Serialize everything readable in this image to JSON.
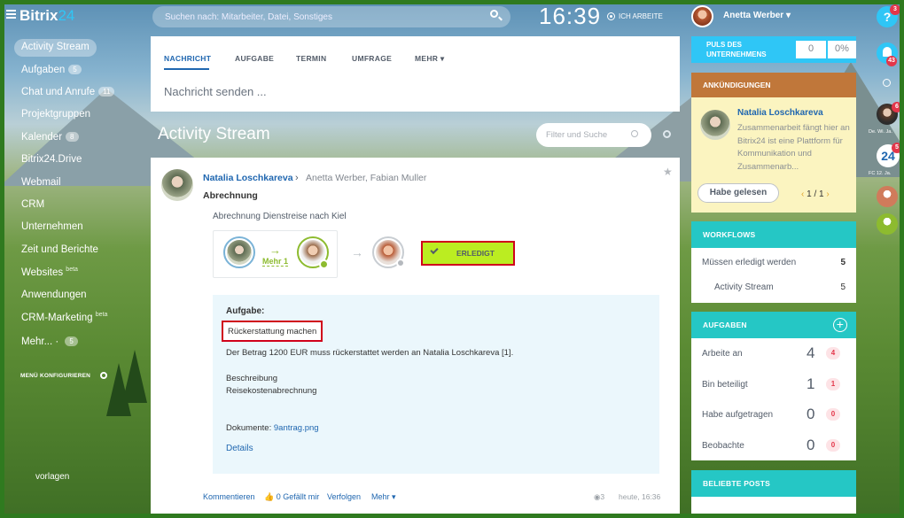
{
  "header": {
    "logo": "Bitrix",
    "logo_num": "24",
    "search_placeholder": "Suchen nach: Mitarbeiter, Datei, Sonstiges",
    "time": "16:39",
    "work_status": "ICH ARBEITE",
    "user_name": "Anetta Werber"
  },
  "menu": {
    "items": [
      {
        "label": "Activity Stream"
      },
      {
        "label": "Aufgaben",
        "count": "5"
      },
      {
        "label": "Chat und Anrufe",
        "count": "11"
      },
      {
        "label": "Projektgruppen"
      },
      {
        "label": "Kalender",
        "count": "8"
      },
      {
        "label": "Bitrix24.Drive"
      },
      {
        "label": "Webmail"
      },
      {
        "label": "CRM"
      },
      {
        "label": "Unternehmen"
      },
      {
        "label": "Zeit und Berichte"
      },
      {
        "label": "Websites",
        "beta": "beta"
      },
      {
        "label": "Anwendungen"
      },
      {
        "label": "CRM-Marketing",
        "beta": "beta"
      },
      {
        "label": "Mehr...",
        "count": "5"
      }
    ],
    "configure": "MENÜ KONFIGURIEREN",
    "templates": "vorlagen"
  },
  "composer": {
    "tabs": [
      "NACHRICHT",
      "AUFGABE",
      "TERMIN",
      "UMFRAGE",
      "MEHR"
    ],
    "placeholder": "Nachricht senden ..."
  },
  "stream": {
    "title": "Activity Stream",
    "filter_placeholder": "Filter und Suche"
  },
  "post": {
    "author": "Natalia Loschkareva",
    "recipients": "Anetta Werber, Fabian Muller",
    "title": "Abrechnung",
    "subtitle": "Abrechnung Dienstreise nach Kiel",
    "workflow_more": "Mehr 1",
    "done_button": "ERLEDIGT",
    "task": {
      "label": "Aufgabe:",
      "name": "Rückerstattung machen",
      "text": "Der Betrag 1200 EUR muss rückerstattet werden an Natalia Loschkareva [1].",
      "desc_label": "Beschreibung",
      "desc_value": "Reisekostenabrechnung",
      "docs_label": "Dokumente:",
      "docs_file": "9antrag.png",
      "details": "Details"
    },
    "footer": {
      "comment": "Kommentieren",
      "like": "0 Gefällt mir",
      "follow": "Verfolgen",
      "more": "Mehr",
      "views": "3",
      "time": "heute, 16:36"
    }
  },
  "right": {
    "puls": {
      "label_1": "PULS DES",
      "label_2": "UNTERNEHMENS",
      "count": "0",
      "percent": "0%"
    },
    "announcements": {
      "title": "ANKÜNDIGUNGEN",
      "author": "Natalia Loschkareva",
      "text": "Zusammenarbeit fängt hier an Bitrix24 ist eine Plattform für Kommunikation und Zusammenarb...",
      "button": "Habe gelesen",
      "pager": "1 / 1"
    },
    "workflows": {
      "title": "WORKFLOWS",
      "rows": [
        {
          "label": "Müssen erledigt werden",
          "value": "5"
        },
        {
          "label": "Activity Stream",
          "value": "5"
        }
      ]
    },
    "tasks": {
      "title": "AUFGABEN",
      "rows": [
        {
          "label": "Arbeite an",
          "value": "4",
          "badge": "4"
        },
        {
          "label": "Bin beteiligt",
          "value": "1",
          "badge": "1"
        },
        {
          "label": "Habe aufgetragen",
          "value": "0",
          "badge": "0"
        },
        {
          "label": "Beobachte",
          "value": "0",
          "badge": "0"
        }
      ]
    },
    "popular": {
      "title": "BELIEBTE POSTS"
    }
  },
  "rightbar": {
    "help_badge": "3",
    "bell_badge": "43",
    "contact1_badge": "6",
    "contact1_label": "De. Wi. Ja.",
    "b24_badge": "5",
    "b24_label": "FC 12. Ja."
  },
  "colors": {
    "accent": "#2fc6f6",
    "link": "#2067b0",
    "done_green": "#bbed21",
    "highlight_red": "#d0021b",
    "teal": "#25c7c5",
    "announce_header": "#c0773a"
  }
}
